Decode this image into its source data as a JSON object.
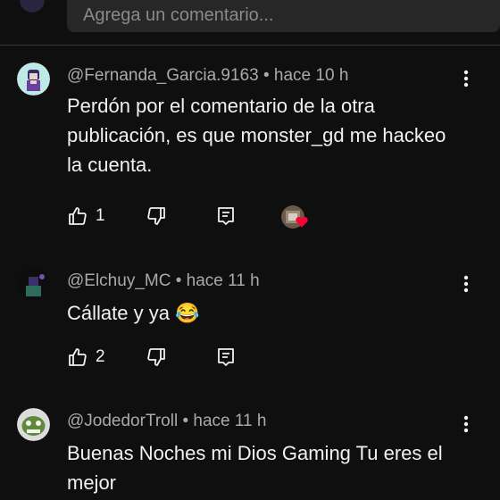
{
  "input": {
    "placeholder": "Agrega un comentario..."
  },
  "comments": [
    {
      "author": "@Fernanda_Garcia.9163",
      "time": "hace 10 h",
      "text": "Perdón por el comentario de la otra publicación, es que monster_gd me hackeo la cuenta.",
      "likes": "1",
      "has_creator_heart": true
    },
    {
      "author": "@Elchuy_MC",
      "time": "hace 11 h",
      "text": "Cállate y ya 😂",
      "likes": "2",
      "has_creator_heart": false
    },
    {
      "author": "@JodedorTroll",
      "time": "hace 11 h",
      "text": "Buenas Noches mi Dios Gaming Tu eres el mejor",
      "likes": "",
      "has_creator_heart": false
    }
  ],
  "separator": "•",
  "colors": {
    "background": "#0f0f0f",
    "meta": "#aaaaaa",
    "heart": "#ff0033",
    "input_bg": "#272727"
  },
  "icons": [
    "like-icon",
    "dislike-icon",
    "reply-icon",
    "more-vert-icon",
    "heart-icon"
  ]
}
